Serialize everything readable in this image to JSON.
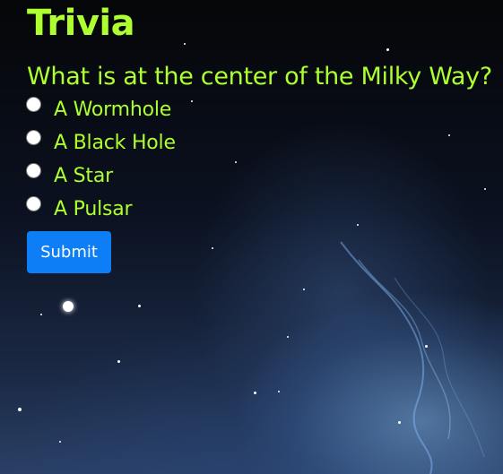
{
  "page": {
    "title": "Trivia",
    "question": "What is at the center of the Milky Way?"
  },
  "options": [
    {
      "label": "A Wormhole",
      "selected": false
    },
    {
      "label": "A Black Hole",
      "selected": false
    },
    {
      "label": "A Star",
      "selected": false
    },
    {
      "label": "A Pulsar",
      "selected": false
    }
  ],
  "submit": {
    "label": "Submit"
  },
  "colors": {
    "text_accent": "#adff2f",
    "button_bg": "#0d7ef5",
    "button_text": "#ffffff"
  }
}
